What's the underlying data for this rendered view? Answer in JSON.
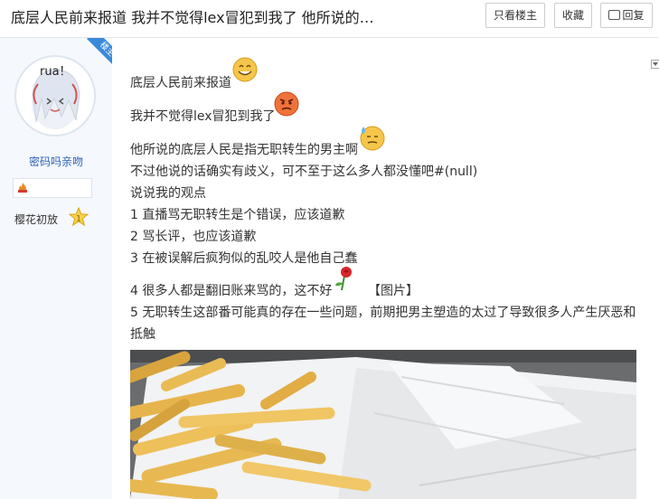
{
  "header": {
    "title": "底层人民前来报道 我并不觉得lex冒犯到我了 他所说的…",
    "only_op_label": "只看楼主",
    "favorite_label": "收藏",
    "reply_label": "回复"
  },
  "author": {
    "badge": "楼主",
    "avatar_text": "rua！",
    "username": "密码吗亲吻",
    "level_name": "樱花初放",
    "level_number": "1"
  },
  "post": {
    "lines": [
      "底层人民前来报道",
      "我并不觉得lex冒犯到我了",
      "他所说的底层人民是指无职转生的男主啊",
      "不过他说的话确实有歧义，可不至于这么多人都没懂吧#(null)",
      "说说我的观点",
      "1 直播骂无职转生是个错误，应该道歉",
      "2 骂长评，也应该道歉",
      "3 在被误解后疯狗似的乱咬人是他自己蠢",
      "4 很多人都是翻旧账来骂的，这不好",
      "【图片】",
      "5 无职转生这部番可能真的存在一些问题，前期把男主塑造的太过了导致很多人产生厌恶和",
      "抵触"
    ]
  },
  "colors": {
    "accent": "#2e63b8",
    "ribbon": "#3b8ad9",
    "sidebar_bg": "#f5f8fd"
  }
}
